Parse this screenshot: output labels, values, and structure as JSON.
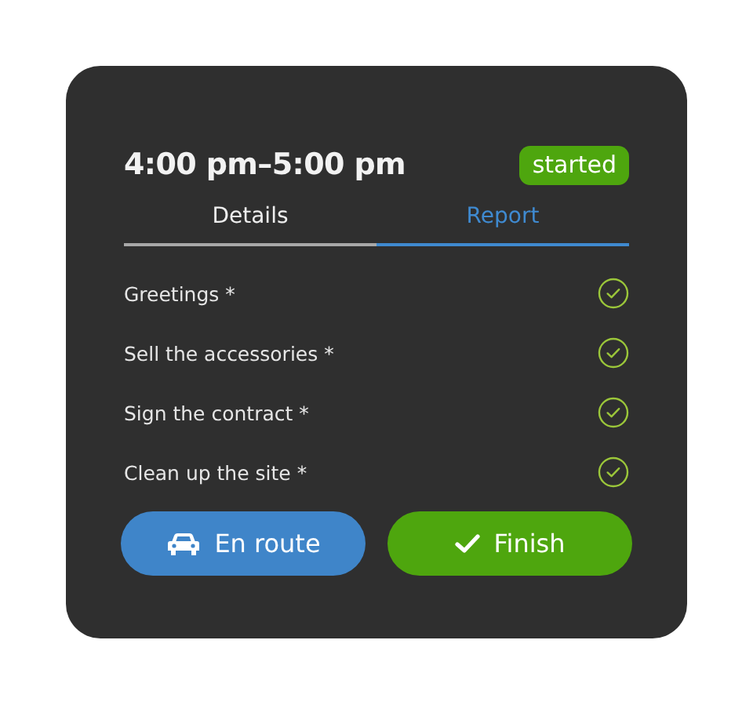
{
  "title": "4:00 pm–5:00 pm",
  "status": "started",
  "tabs": [
    {
      "label": "Details",
      "selected": false
    },
    {
      "label": "Report",
      "selected": true
    }
  ],
  "tasks": [
    {
      "label": "Greetings *",
      "checked": true
    },
    {
      "label": "Sell the accessories *",
      "checked": true
    },
    {
      "label": "Sign the contract *",
      "checked": true
    },
    {
      "label": "Clean up the site *",
      "checked": true
    }
  ],
  "buttons": [
    {
      "label": "En route",
      "kind": "drive"
    },
    {
      "label": "Finish",
      "kind": "finish"
    }
  ]
}
